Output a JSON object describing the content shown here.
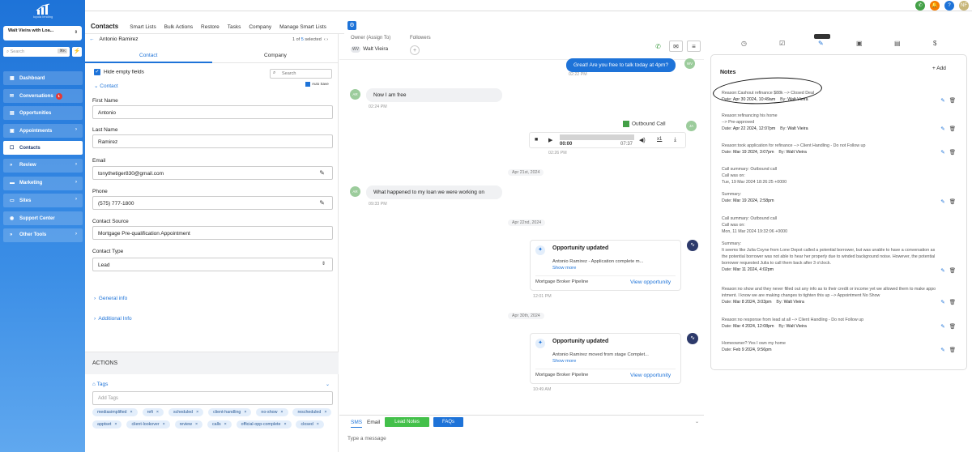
{
  "sidebar": {
    "logo_text": "loyola lending",
    "account_name": "Walt Vieira with Loa...",
    "search_placeholder": "Search",
    "search_kbd": "⌘K",
    "items": [
      {
        "label": "Dashboard",
        "icon": "dashboard-icon"
      },
      {
        "label": "Conversations",
        "icon": "chat-icon",
        "badge": "1"
      },
      {
        "label": "Opportunities",
        "icon": "funnel-icon"
      },
      {
        "label": "Appointments",
        "icon": "calendar-icon"
      },
      {
        "label": "Contacts",
        "icon": "contacts-icon",
        "active": true
      },
      {
        "label": "Review",
        "icon": "star-icon"
      },
      {
        "label": "Marketing",
        "icon": "megaphone-icon"
      },
      {
        "label": "Sites",
        "icon": "globe-icon"
      },
      {
        "label": "Support Center",
        "icon": "help-icon"
      },
      {
        "label": "Other Tools",
        "icon": "tools-icon"
      }
    ]
  },
  "topbar": {
    "notif_count": "1",
    "avatar": "NF"
  },
  "tabs": {
    "title": "Contacts",
    "items": [
      "Smart Lists",
      "Bulk Actions",
      "Restore",
      "Tasks",
      "Company",
      "Manage Smart Lists"
    ]
  },
  "contact": {
    "name": "Antonio Ramirez",
    "pager": {
      "of": "1 of",
      "count": "5",
      "selected": "selected"
    },
    "subtab_contact": "Contact",
    "subtab_company": "Company",
    "hide_empty": "Hide empty fields",
    "search_placeholder": "Search",
    "section": "Contact",
    "autosave": "Auto Save",
    "first_name_label": "First Name",
    "first_name": "Antonio",
    "last_name_label": "Last Name",
    "last_name": "Ramirez",
    "email_label": "Email",
    "email": "tonythetiger830@gmail.com",
    "phone_label": "Phone",
    "phone": "(575) 777-1800",
    "source_label": "Contact Source",
    "source": "Mortgage Pre-qualification Appointment",
    "type_label": "Contact Type",
    "type": "Lead",
    "general_info": "General info",
    "additional_info": "Additional Info",
    "actions": "ACTIONS",
    "tags_label": "Tags",
    "add_tags": "Add Tags",
    "tags": [
      "mediasimplified",
      "refi",
      "scheduled",
      "client-handling",
      "no-show",
      "rescheduled",
      "apptset",
      "client-lookover",
      "review",
      "calls",
      "official-opp-complete",
      "closed"
    ]
  },
  "conversation": {
    "owner_label": "Owner (Assign To)",
    "owner_initials": "WV",
    "owner_name": "Walt Vieira",
    "followers_label": "Followers",
    "msg1": "Great! Are you free to talk today at 4pm?",
    "msg1_time": "02:22 PM",
    "msg1_avatar": "WV",
    "msg2": "Now I am free",
    "msg2_time": "02:24 PM",
    "msg2_avatar": "AR",
    "outbound_call": "Outbound Call",
    "call_avatar": "JA",
    "audio_start": "00:00",
    "audio_end": "07:37",
    "audio_speed": "x1",
    "call_time": "02:26 PM",
    "day1": "Apr 21st, 2024",
    "msg3": "What happened to my loan we were working on",
    "msg3_time": "09:33 PM",
    "msg3_avatar": "AR",
    "day2": "Apr 22nd, 2024",
    "card1": {
      "title": "Opportunity updated",
      "desc": "Antonio Ramirez - Application complete m...",
      "more": "Show more",
      "pipeline": "Mortgage Broker Pipeline",
      "view": "View opportunity",
      "time": "12:01 PM"
    },
    "day3": "Apr 30th, 2024",
    "card2": {
      "title": "Opportunity updated",
      "desc": "Antonio Ramirez moved from stage Complet...",
      "more": "Show more",
      "pipeline": "Mortgage Broker Pipeline",
      "view": "View opportunity",
      "time": "10:49 AM"
    },
    "composer": {
      "sms": "SMS",
      "email": "Email",
      "lead_notes": "Lead Notes",
      "faqs": "FAQs",
      "placeholder": "Type a message"
    }
  },
  "notes": {
    "title": "Notes",
    "add": "Add",
    "items": [
      {
        "lines": [
          "Reason:Cashout refinance $88k --> Closed Deal"
        ],
        "date": "Apr 30 2024, 10:49am",
        "by": "Walt Vieira"
      },
      {
        "lines": [
          "Reason:refinancing his home",
          "--> Pre-approved"
        ],
        "date": "Apr 22 2024, 12:07pm",
        "by": "Walt Vieira"
      },
      {
        "lines": [
          "Reason:took application for refinance --> Client Handling - Do not Follow up"
        ],
        "date": "Mar 19 2024, 3:07pm",
        "by": "Walt Vieira"
      },
      {
        "lines": [
          "Call summary: Outbound call",
          "Call was on:",
          "Tue, 19 Mar 2024 18:26:25 +0000",
          "",
          "Summary:"
        ],
        "date": "Mar 19 2024, 2:58pm",
        "by": ""
      },
      {
        "lines": [
          "Call summary: Outbound call",
          "Call was on:",
          "Mon, 11 Mar 2024 19:32:06 +0000",
          "",
          "Summary:",
          "It seems like Julia Coyne from Lone Depot called a potential borrower, but was unable to have a conversation as",
          "the potential borrower was not able to hear her properly due to winded background noise. However, the potential",
          "borrower requested Julia to call them back after 3 o'clock."
        ],
        "date": "Mar 11 2024, 4:02pm",
        "by": ""
      },
      {
        "lines": [
          "Reason:no show and they never filled out any info as to their credit or income yet we allowed them to make appo",
          "intment. I know we are making changes to tighten this up --> Appointment No Show"
        ],
        "date": "Mar 8 2024, 3:03pm",
        "by": "Walt Vieira"
      },
      {
        "lines": [
          "Reason:no response from lead at all --> Client Handling - Do not Follow up"
        ],
        "date": "Mar 4 2024, 12:08pm",
        "by": "Walt Vieira"
      },
      {
        "lines": [
          "Homeowner?:Yes I own my home"
        ],
        "date": "Feb 9 2024, 9:56pm",
        "by": ""
      }
    ]
  }
}
